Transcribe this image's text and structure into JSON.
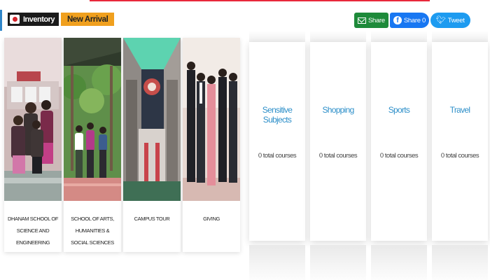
{
  "header": {
    "inventory_label": "Inventory",
    "new_arrival_label": "New Arrival"
  },
  "share": {
    "email_label": "Share",
    "facebook_label": "Share 0",
    "twitter_label": "Tweet"
  },
  "photo_cards": [
    {
      "caption": "DHANAM SCHOOL OF SCIENCE AND ENGINEERING"
    },
    {
      "caption": "SCHOOL OF ARTS, HUMANITIES & SOCIAL SCIENCES"
    },
    {
      "caption": "CAMPUS TOUR"
    },
    {
      "caption": "GIVING"
    }
  ],
  "categories": [
    {
      "title": "Sensitive Subjects",
      "count": "0 total courses"
    },
    {
      "title": "Shopping",
      "count": "0 total courses"
    },
    {
      "title": "Sports",
      "count": "0 total courses"
    },
    {
      "title": "Travel",
      "count": "0 total courses"
    }
  ],
  "colors": {
    "accent_red": "#e8283b",
    "accent_blue": "#2f86c9",
    "badge_orange": "#f0a01e",
    "category_title": "#2d8fc9"
  }
}
